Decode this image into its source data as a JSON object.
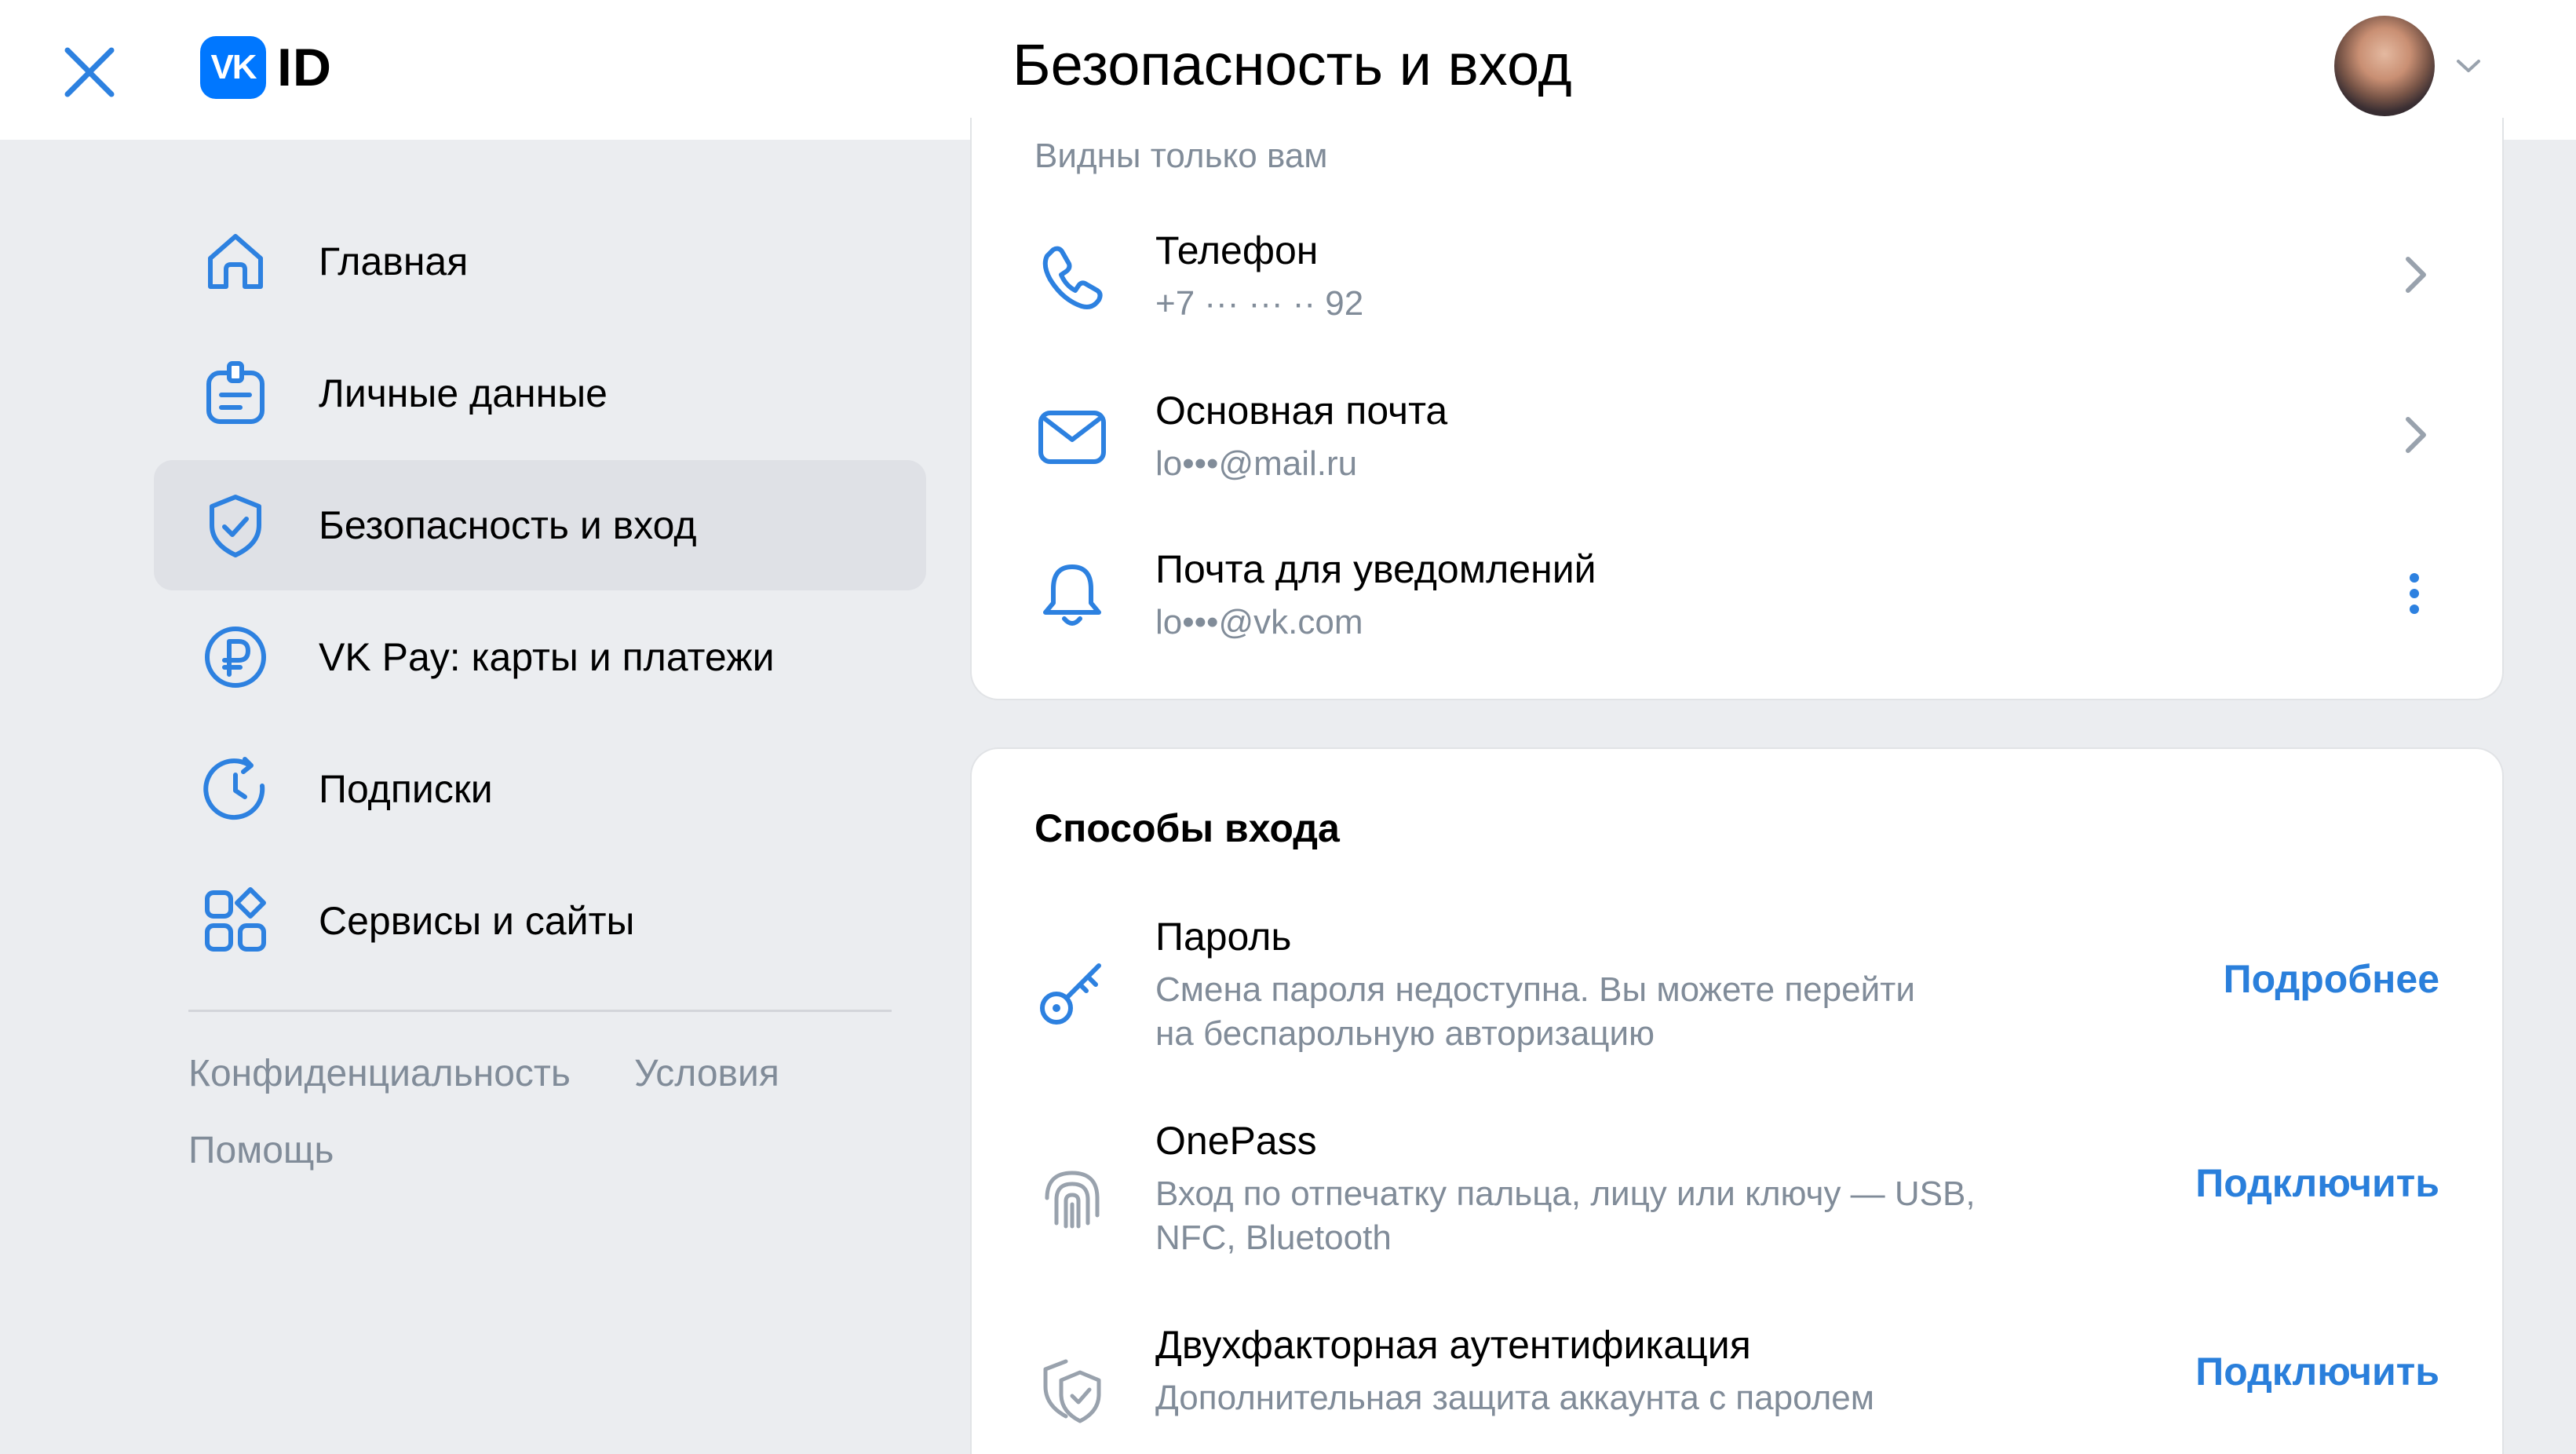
{
  "header": {
    "logo_mark": "VK",
    "logo_text": "ID",
    "title": "Безопасность и вход"
  },
  "sidebar": {
    "items": [
      {
        "label": "Главная",
        "icon": "home-icon",
        "active": false
      },
      {
        "label": "Личные данные",
        "icon": "id-card-icon",
        "active": false
      },
      {
        "label": "Безопасность и вход",
        "icon": "shield-check-icon",
        "active": true
      },
      {
        "label": "VK Pay: карты и платежи",
        "icon": "ruble-icon",
        "active": false
      },
      {
        "label": "Подписки",
        "icon": "clock-refresh-icon",
        "active": false
      },
      {
        "label": "Сервисы и сайты",
        "icon": "apps-grid-icon",
        "active": false
      }
    ],
    "footer": {
      "privacy": "Конфиденциальность",
      "terms": "Условия",
      "help": "Помощь"
    }
  },
  "contacts": {
    "caption": "Видны только вам",
    "items": [
      {
        "title": "Телефон",
        "value": "+7 ··· ··· ·· 92",
        "icon": "phone-icon",
        "trailing": "chevron-right-icon"
      },
      {
        "title": "Основная почта",
        "value": "lo•••@mail.ru",
        "icon": "mail-icon",
        "trailing": "chevron-right-icon"
      },
      {
        "title": "Почта для уведомлений",
        "value": "lo•••@vk.com",
        "icon": "bell-icon",
        "trailing": "more-vertical-icon"
      }
    ]
  },
  "login_methods": {
    "title": "Способы входа",
    "items": [
      {
        "title": "Пароль",
        "desc_line1": "Смена пароля недоступна. Вы можете перейти",
        "desc_line2": "на беспарольную авторизацию",
        "action": "Подробнее",
        "icon": "key-icon"
      },
      {
        "title": "OnePass",
        "desc_line1": "Вход по отпечатку пальца, лицу или ключу — USB,",
        "desc_line2": "NFC, Bluetooth",
        "action": "Подключить",
        "icon": "fingerprint-icon"
      },
      {
        "title": "Двухфакторная аутентификация",
        "desc_line1": "Дополнительная защита аккаунта с паролем",
        "action": "Подключить",
        "icon": "shield-2fa-icon"
      }
    ]
  },
  "colors": {
    "accent": "#0077ff",
    "link": "#2a7fdb",
    "icon_blue": "#2d81e0",
    "secondary_text": "#818c99",
    "background": "#ebedf0",
    "active_nav": "#dfe1e6"
  }
}
